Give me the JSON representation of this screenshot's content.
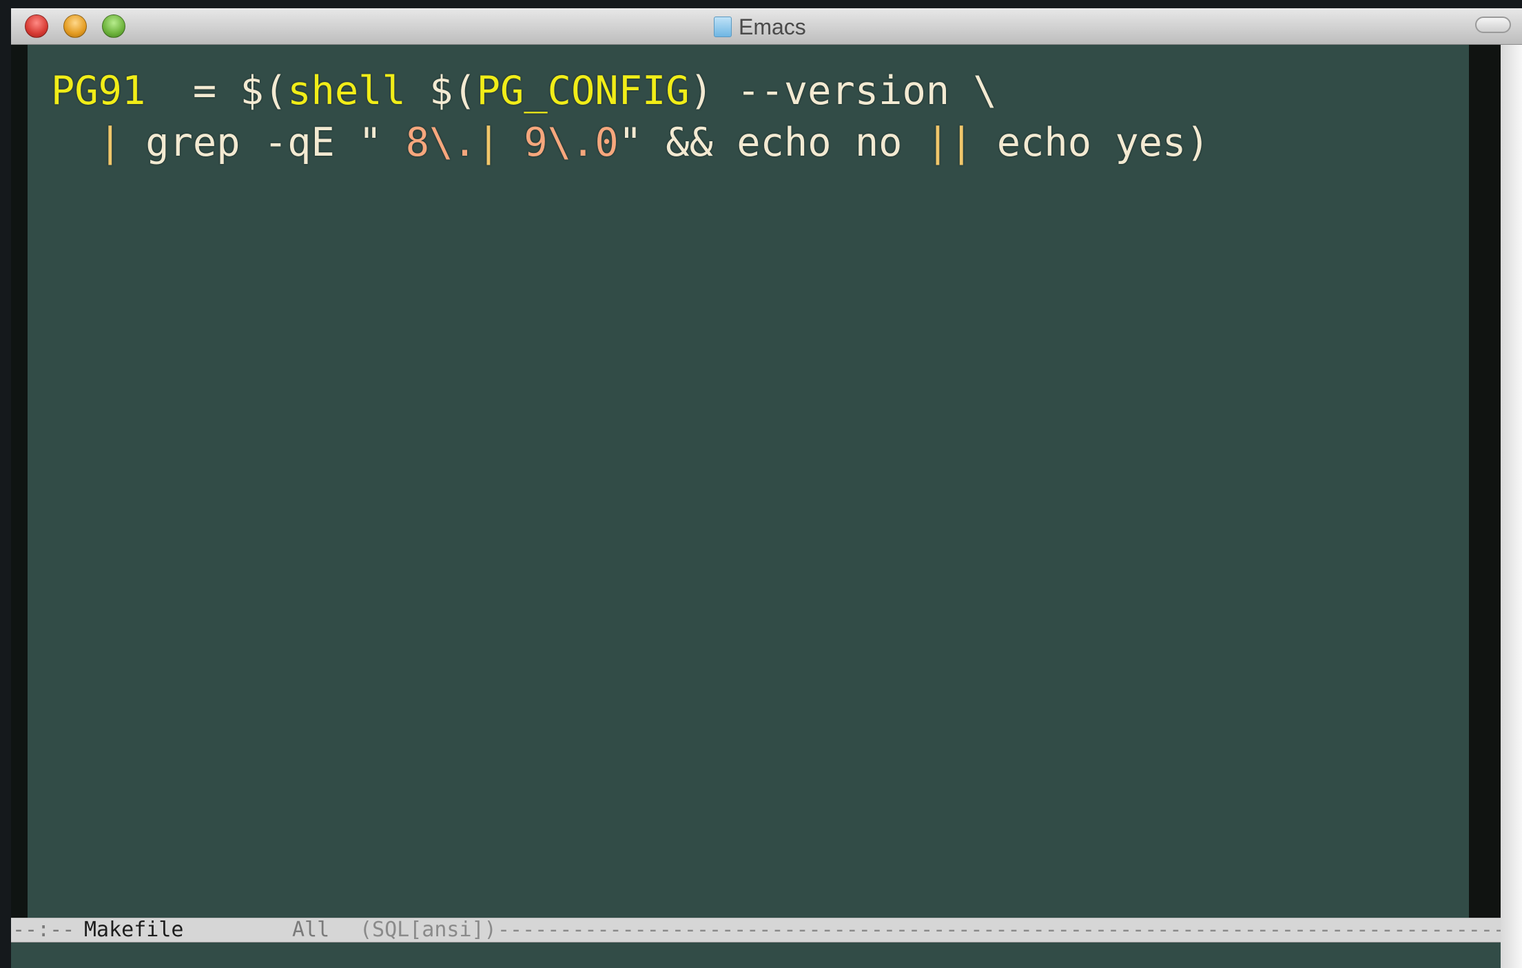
{
  "window": {
    "title": "Emacs"
  },
  "editor": {
    "line1": {
      "var_name": "PG91",
      "assign": "  = $(",
      "shell_kw": "shell",
      "space": " $(",
      "config": "PG_CONFIG",
      "rest": ") --version \\"
    },
    "line2": {
      "indent": "  ",
      "pipe1": "|",
      "grep": " grep -qE \"",
      "str1": " 8\\.",
      "pipe2": "|",
      "str2": " 9\\.0",
      "quote_close": "\" && echo no ",
      "pipe3": "||",
      "tail": " echo yes)"
    }
  },
  "modeline": {
    "flags": "--:--",
    "buffer_name": "Makefile",
    "position": "All",
    "major_mode": "(SQL[ansi])",
    "dashes": "--------------------------------------------------------------------------------------------------------------"
  },
  "colors": {
    "background": "#324c47",
    "identifier": "#f1ed18",
    "foreground": "#f3ead2",
    "string": "#f6a77d",
    "pipe": "#f1c76b"
  },
  "icons": {
    "close": "close-icon",
    "minimize": "minimize-icon",
    "zoom": "zoom-icon",
    "document": "document-icon"
  }
}
